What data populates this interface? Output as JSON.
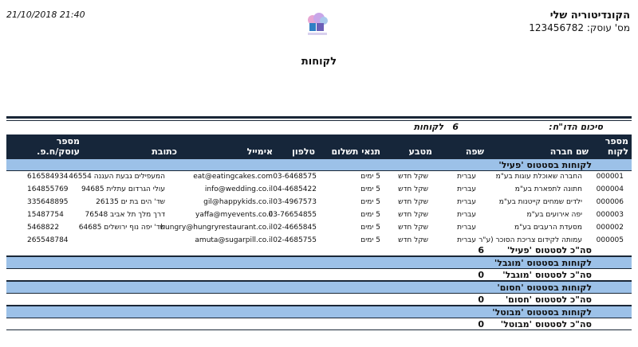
{
  "header": {
    "company_name": "הקונדיטוריה שלי",
    "tax_id_label": "מס' עוסק:",
    "tax_id": "123456782",
    "datetime": "21/10/2018 21:40",
    "title": "לקוחות"
  },
  "summary": {
    "label": "סיכום הדו\"ח:",
    "count": "6",
    "unit": "לקוחות"
  },
  "columns": {
    "code": "מספר לקוח",
    "company": "שם חברה",
    "language": "שפה",
    "currency": "מטבע",
    "payment_terms": "תנאי תשלום",
    "phone": "טלפון",
    "email": "אימייל",
    "address": "כתובת",
    "tax_id": "מספר עוסק/ח.פ."
  },
  "groups": [
    {
      "title": "לקוחות בסטטוס 'פעיל'",
      "total_label": "סה\"כ לסטטוס 'פעיל'",
      "total": "6",
      "rows": [
        {
          "code": "000001",
          "company": "החברה שאוכלת עוגות בע\"מ",
          "language": "עברית",
          "currency": "שקל חדש",
          "terms": "5 ימים",
          "phone": "03-6468575",
          "email": "eat@eatingcakes.com",
          "address": "המעפילים גבעת העגנה 46554",
          "tax_id": "616584934"
        },
        {
          "code": "000004",
          "company": "חתונה לתפארת בע\"מ",
          "language": "עברית",
          "currency": "שקל חדש",
          "terms": "5 ימים",
          "phone": "04-4685422",
          "email": "info@wedding.co.il",
          "address": "עולי הגרדום עתלית 94685",
          "tax_id": "164855769"
        },
        {
          "code": "000006",
          "company": "ילדים שמחים קייטנות בע\"מ",
          "language": "עברית",
          "currency": "שקל חדש",
          "terms": "5 ימים",
          "phone": "03-4967573",
          "email": "gil@happykids.co.il",
          "address": "שד' הים בת ים 26135",
          "tax_id": "335648895"
        },
        {
          "code": "000003",
          "company": "יפה אירועים בע\"מ",
          "language": "עברית",
          "currency": "שקל חדש",
          "terms": "5 ימים",
          "phone": "03-76654855",
          "email": "yaffa@myevents.co.il",
          "address": "דרך מלך תל אביב 76548",
          "tax_id": "15487754"
        },
        {
          "code": "000002",
          "company": "מסעדת הרעבים בע\"מ",
          "language": "עברית",
          "currency": "שקל חדש",
          "terms": "5 ימים",
          "phone": "02-4665845",
          "email": "hungry@hungryrestaurant.co.il",
          "address": "שד' יפה נוף ירושלים 64685",
          "tax_id": "5468822"
        },
        {
          "code": "000005",
          "company": "עמותה לקידום צריכת הסוכר (ע\"ר",
          "language": "עברית",
          "currency": "שקל חדש",
          "terms": "5 ימים",
          "phone": "02-4685755",
          "email": "amuta@sugarpill.co.il",
          "address": "",
          "tax_id": "265548784"
        }
      ]
    },
    {
      "title": "לקוחות בסטטוס 'מוגבל'",
      "total_label": "סה\"כ לסטטוס 'מוגבל'",
      "total": "0",
      "rows": []
    },
    {
      "title": "לקוחות בסטטוס 'חסום'",
      "total_label": "סה\"כ לסטטוס 'חסום'",
      "total": "0",
      "rows": []
    },
    {
      "title": "לקוחות בסטטוס 'מבוטל'",
      "total_label": "סה\"כ לסטטוס 'מבוטל'",
      "total": "0",
      "rows": []
    }
  ]
}
